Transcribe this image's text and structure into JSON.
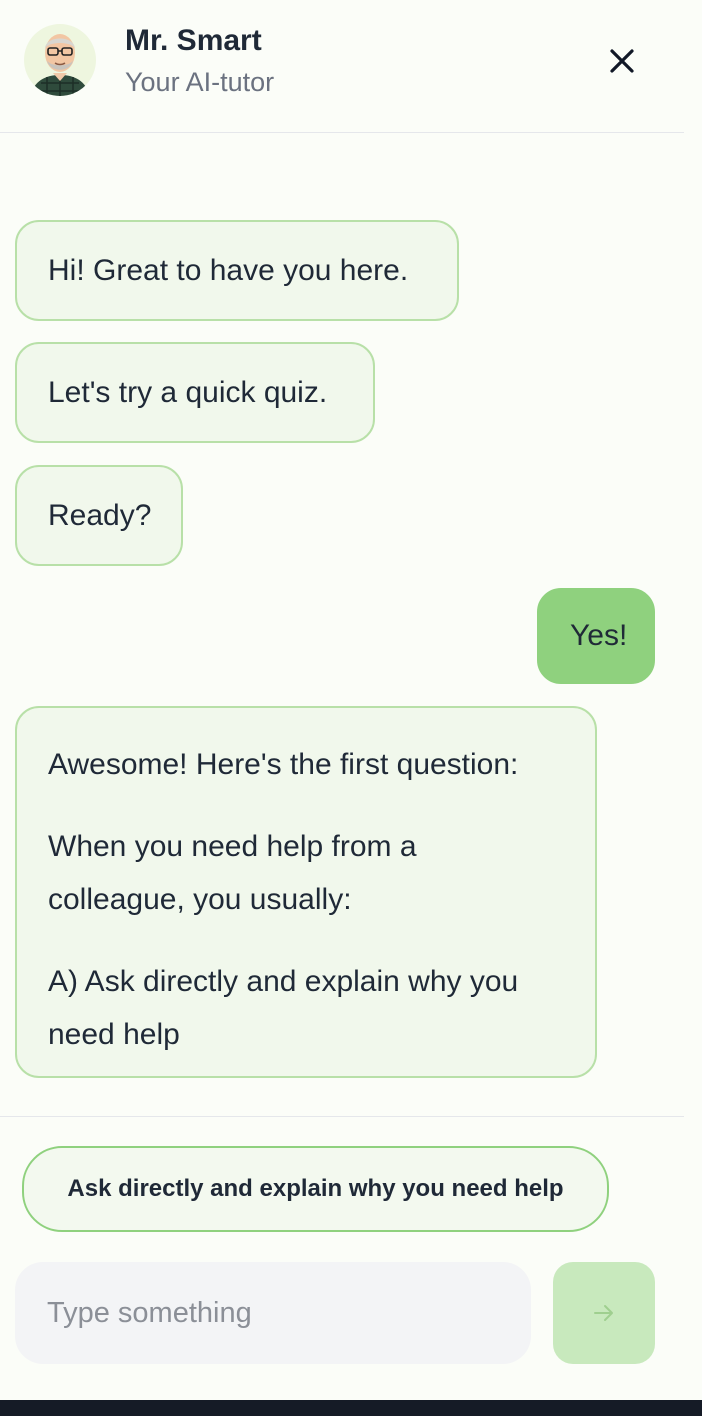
{
  "header": {
    "title": "Mr. Smart",
    "subtitle": "Your AI-tutor",
    "close_icon": "close-icon",
    "avatar_icon": "tutor-avatar"
  },
  "messages": [
    {
      "sender": "tutor",
      "paragraphs": [
        "Hi! Great to have you here."
      ]
    },
    {
      "sender": "tutor",
      "paragraphs": [
        "Let's try a quick quiz."
      ]
    },
    {
      "sender": "tutor",
      "paragraphs": [
        "Ready?"
      ]
    },
    {
      "sender": "user",
      "paragraphs": [
        "Yes!"
      ]
    },
    {
      "sender": "tutor",
      "paragraphs": [
        "Awesome! Here's the first question:",
        "When you need help from a",
        "colleague, you usually:",
        "A) Ask directly and explain why you",
        "need help"
      ]
    }
  ],
  "suggestion": {
    "label": "Ask directly and explain why you need help"
  },
  "composer": {
    "placeholder": "Type something",
    "value": "",
    "send_icon": "arrow-right-icon"
  },
  "colors": {
    "background": "#fbfdf8",
    "tutor_bubble": "#f1f8ec",
    "tutor_border": "#b8e0a8",
    "user_bubble": "#8fd17e",
    "send_disabled": "#c8e9bd",
    "bottom_bar": "#151b26"
  }
}
